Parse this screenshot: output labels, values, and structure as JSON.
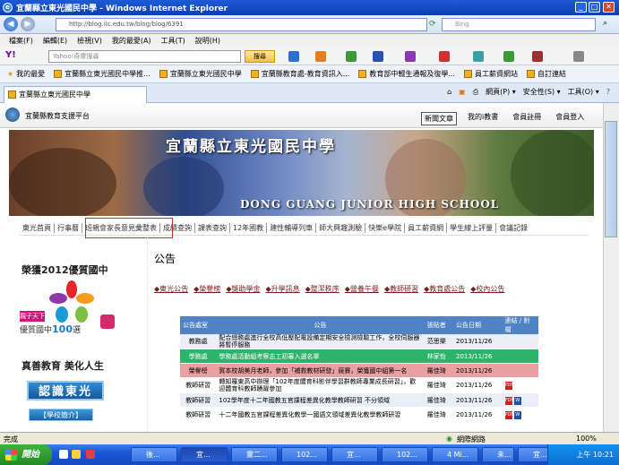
{
  "window": {
    "title": "宜蘭縣立東光國民中學 - Windows Internet Explorer",
    "minimize": "_",
    "maximize": "□",
    "close": "✕"
  },
  "addressbar": {
    "url": "http://blog.ilc.edu.tw/blog/blog/6391",
    "search_placeholder": "Bing"
  },
  "menubar": {
    "items": [
      "檔案(F)",
      "編輯(E)",
      "檢視(V)",
      "我的最愛(A)",
      "工具(T)",
      "說明(H)"
    ]
  },
  "yahoo": {
    "search_placeholder": "Yahoo!奇摩搜尋",
    "search_button": "搜尋"
  },
  "favorites": {
    "items": [
      "我的最愛",
      "宜蘭縣立東光國民中學推...",
      "宜蘭縣立東光國民中學",
      "宜蘭縣教育處-教育資訊入...",
      "教育部中輟生通報及復學...",
      "員工薪資網站",
      "自訂連結"
    ]
  },
  "tabs": {
    "active": "宜蘭縣立東光國民中學",
    "commands": [
      "網頁(P) ▾",
      "安全性(S) ▾",
      "工具(O) ▾"
    ]
  },
  "platform": {
    "title": "宜蘭縣教育支援平台",
    "new_post": "新聞文章",
    "links": [
      "我的i教書",
      "會員註冊",
      "會員登入"
    ]
  },
  "banner": {
    "title": "宜蘭縣立東光國民中學",
    "subtitle": "DONG GUANG JUNIOR HIGH SCHOOL"
  },
  "nav": {
    "items": [
      "東光首頁",
      "行事曆",
      "班親會家長意見彙整表",
      "成績查詢",
      "課表查詢",
      "12年國教",
      "建性輔導列車",
      "師大興趣測驗",
      "快樂e學院",
      "員工薪資網",
      "學生線上評量",
      "會議記錄"
    ]
  },
  "sidebar": {
    "honor": "榮獲2012優質國中",
    "qiao": "親子天下",
    "hundred_prefix": "優質國中",
    "hundred_num": "100",
    "hundred_suffix": "選",
    "slogan": "真善教育 美化人生",
    "know_button": "認識東光",
    "intro_button": "【學校簡介】"
  },
  "announcements": {
    "title": "公告",
    "categories": [
      "◆東光公告",
      "◆榮譽榜",
      "◆獎助學金",
      "◆升學訊息",
      "◆整潔秩序",
      "◆營養午餐",
      "◆教師研習",
      "◆教育處公告",
      "◆校內公告"
    ],
    "headers": [
      "公告處室",
      "公告",
      "張貼者",
      "公告日期",
      "連結 / 附檔"
    ],
    "rows": [
      {
        "dept": "教務處",
        "subject": "配合總務處進行全校高低壓配電設備定期安全檢測檢驗工作，全校伺服器將暫停服務",
        "poster": "范思樂",
        "date": "2013/11/26",
        "att": ""
      },
      {
        "dept": "學務處",
        "subject": "學務處活動組考察志工初審入選名單",
        "poster": "林家怡",
        "date": "2013/11/26",
        "att": ""
      },
      {
        "dept": "榮譽榜",
        "subject": "賀本校胡美月老師，參加「補救教材研發」競賽，榮獲國中組第一名",
        "poster": "羅佳琦",
        "date": "2013/11/26",
        "att": ""
      },
      {
        "dept": "教師研習",
        "subject": "轉知羅東高中辦理「102年度體育科影伴學習群教師專業成長研習」，歡迎體育科教師踴躍參加",
        "poster": "羅佳琦",
        "date": "2013/11/26",
        "att": "pdf"
      },
      {
        "dept": "教師研習",
        "subject": "102學年度十二年國教五官課程差異化教學教師研習 不分領域",
        "poster": "羅佳琦",
        "date": "2013/11/26",
        "att": "pdfdoc"
      },
      {
        "dept": "教師研習",
        "subject": "十二年國教五官課程差異化教學一國語文領域差異化教學教師研習",
        "poster": "羅佳琦",
        "date": "2013/11/26",
        "att": "pdfdoc"
      }
    ]
  },
  "status": {
    "left": "完成",
    "zone": "網際網路",
    "zoom": "100%"
  },
  "taskbar": {
    "start": "開始",
    "tasks": [
      "後...",
      "宜...",
      "靈二...",
      "102...",
      "宜...",
      "102...",
      "4 Mi...",
      "未...",
      "宜..."
    ],
    "clock": "上午 10:21"
  }
}
